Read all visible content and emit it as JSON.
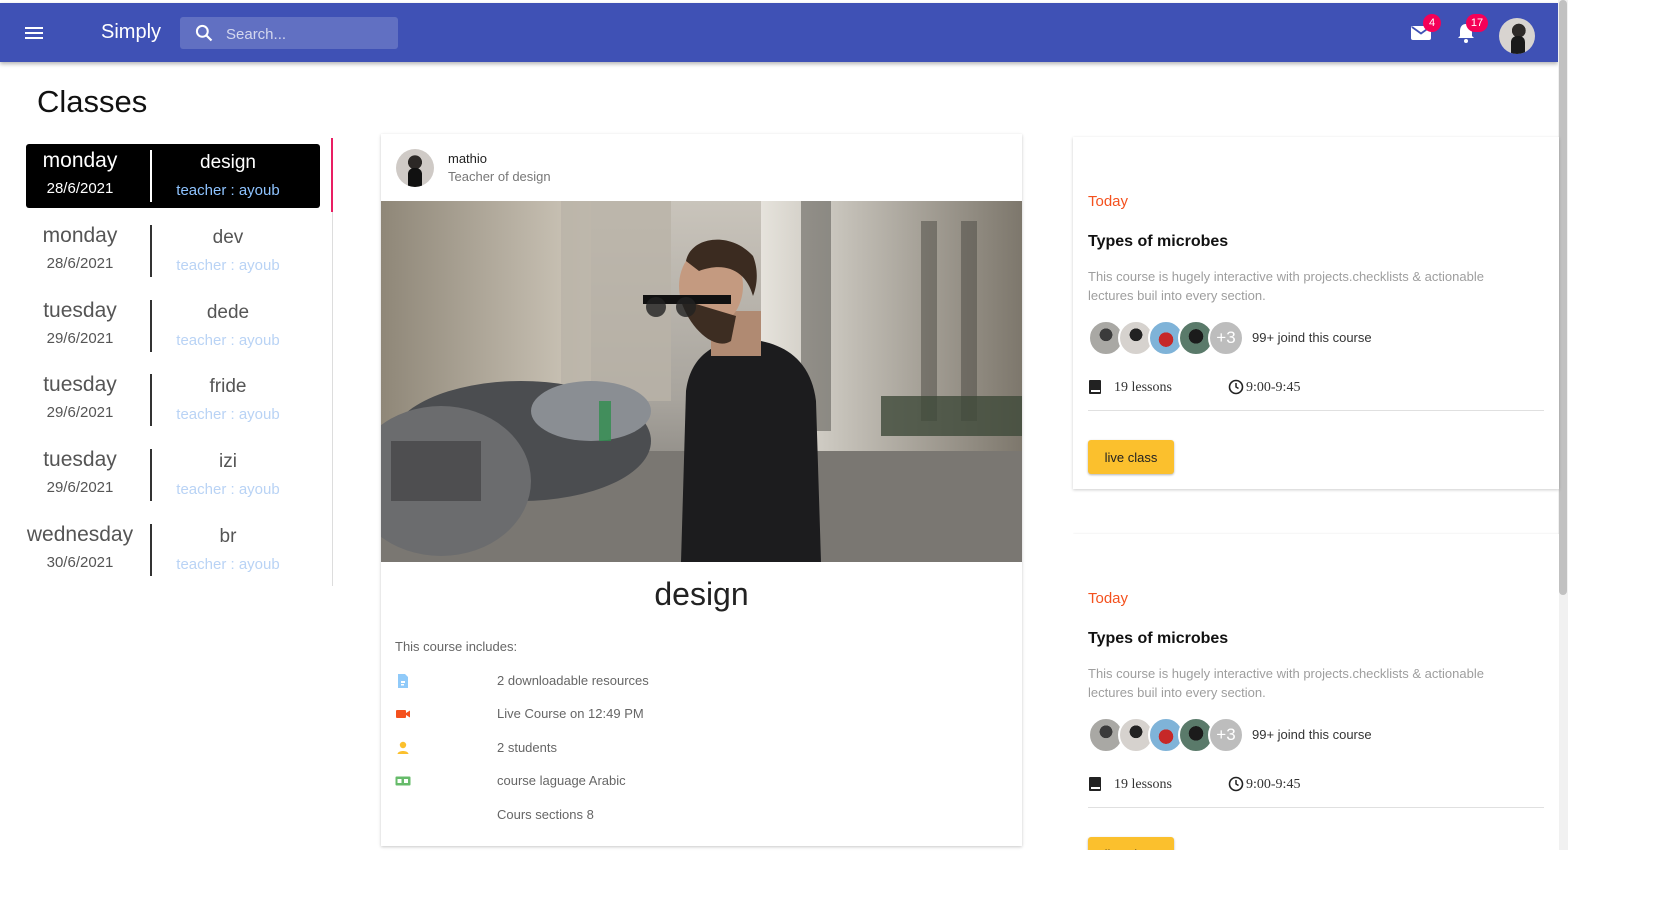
{
  "header": {
    "brand": "Simply",
    "search_placeholder": "Search...",
    "mail_count": "4",
    "notification_count": "17"
  },
  "page_title": "Classes",
  "classes": [
    {
      "day": "monday",
      "date": "28/6/2021",
      "subject": "design",
      "teacher": "teacher : ayoub",
      "active": true
    },
    {
      "day": "monday",
      "date": "28/6/2021",
      "subject": "dev",
      "teacher": "teacher : ayoub"
    },
    {
      "day": "tuesday",
      "date": "29/6/2021",
      "subject": "dede",
      "teacher": "teacher : ayoub"
    },
    {
      "day": "tuesday",
      "date": "29/6/2021",
      "subject": "fride",
      "teacher": "teacher : ayoub"
    },
    {
      "day": "tuesday",
      "date": "29/6/2021",
      "subject": "izi",
      "teacher": "teacher : ayoub"
    },
    {
      "day": "wednesday",
      "date": "30/6/2021",
      "subject": "br",
      "teacher": "teacher : ayoub"
    }
  ],
  "course": {
    "author": "mathio",
    "role": "Teacher of design",
    "title": "design",
    "includes_label": "This course includes:",
    "features": [
      {
        "icon": "file-icon",
        "text": "2 downloadable resources",
        "color": "#90caf9"
      },
      {
        "icon": "video-camera-icon",
        "text": "Live Course on 12:49 PM",
        "color": "#f4511e"
      },
      {
        "icon": "person-icon",
        "text": "2 students",
        "color": "#fbc02d"
      },
      {
        "icon": "language-icon",
        "text": "course laguage Arabic",
        "color": "#66bb6a"
      },
      {
        "icon": "",
        "text": "Cours sections 8",
        "color": ""
      }
    ]
  },
  "upcoming": [
    {
      "today": "Today",
      "title": "Types of microbes",
      "description": "This course is hugely interactive with projects.checklists & actionable lectures buil into every section.",
      "more_count": "+3",
      "joined": "99+ joind this course",
      "lessons": "19 lessons",
      "time": "9:00-9:45",
      "button": "live class"
    },
    {
      "today": "Today",
      "title": "Types of microbes",
      "description": "This course is hugely interactive with projects.checklists & actionable lectures buil into every section.",
      "more_count": "+3",
      "joined": "99+ joind this course",
      "lessons": "19 lessons",
      "time": "9:00-9:45",
      "button": "live class"
    }
  ],
  "colors": {
    "appbar": "#3f51b5",
    "badge": "#f50057",
    "today": "#f4511e",
    "button": "#fbc02d",
    "active_accent": "#e91e63"
  }
}
